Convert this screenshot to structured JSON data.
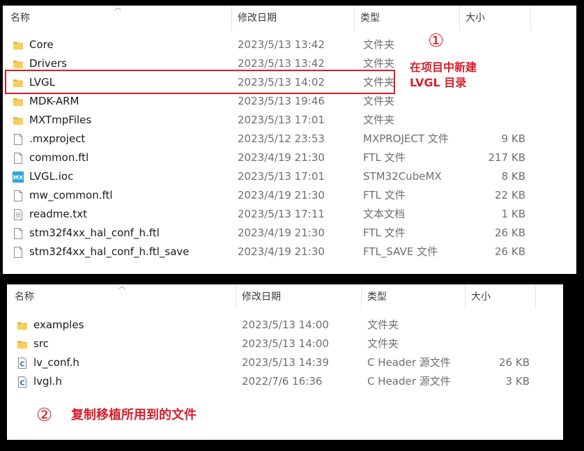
{
  "colors": {
    "accent_red": "#d81e2a",
    "folder_yellow": "#f2c94c",
    "mx_blue": "#2ea3dc"
  },
  "columns": {
    "name": "名称",
    "modified": "修改日期",
    "type": "类型",
    "size": "大小"
  },
  "panel1": {
    "rows": [
      {
        "icon": "folder-icon",
        "name": "Core",
        "modified": "2023/5/13 13:42",
        "type": "文件夹",
        "size": ""
      },
      {
        "icon": "folder-icon",
        "name": "Drivers",
        "modified": "2023/5/13 13:42",
        "type": "文件夹",
        "size": ""
      },
      {
        "icon": "folder-icon",
        "name": "LVGL",
        "modified": "2023/5/13 14:02",
        "type": "文件夹",
        "size": ""
      },
      {
        "icon": "folder-icon",
        "name": "MDK-ARM",
        "modified": "2023/5/13 19:46",
        "type": "文件夹",
        "size": ""
      },
      {
        "icon": "folder-icon",
        "name": "MXTmpFiles",
        "modified": "2023/5/13 17:01",
        "type": "文件夹",
        "size": ""
      },
      {
        "icon": "file-icon",
        "name": ".mxproject",
        "modified": "2023/5/12 23:53",
        "type": "MXPROJECT 文件",
        "size": "9 KB"
      },
      {
        "icon": "file-icon",
        "name": "common.ftl",
        "modified": "2023/4/19 21:30",
        "type": "FTL 文件",
        "size": "217 KB"
      },
      {
        "icon": "mx-icon",
        "name": "LVGL.ioc",
        "modified": "2023/5/13 17:01",
        "type": "STM32CubeMX",
        "size": "8 KB"
      },
      {
        "icon": "file-icon",
        "name": "mw_common.ftl",
        "modified": "2023/4/19 21:30",
        "type": "FTL 文件",
        "size": "22 KB"
      },
      {
        "icon": "text-file-icon",
        "name": "readme.txt",
        "modified": "2023/5/13 17:11",
        "type": "文本文档",
        "size": "1 KB"
      },
      {
        "icon": "file-icon",
        "name": "stm32f4xx_hal_conf_h.ftl",
        "modified": "2023/4/19 21:30",
        "type": "FTL 文件",
        "size": "26 KB"
      },
      {
        "icon": "file-icon",
        "name": "stm32f4xx_hal_conf_h.ftl_save",
        "modified": "2023/4/19 21:30",
        "type": "FTL_SAVE 文件",
        "size": "26 KB"
      }
    ],
    "annotation_number": "①",
    "annotation_line1": "在项目中新建",
    "annotation_line2": "LVGL 目录"
  },
  "panel2": {
    "rows": [
      {
        "icon": "folder-icon",
        "name": "examples",
        "modified": "2023/5/13 14:00",
        "type": "文件夹",
        "size": ""
      },
      {
        "icon": "folder-icon",
        "name": "src",
        "modified": "2023/5/13 14:00",
        "type": "文件夹",
        "size": ""
      },
      {
        "icon": "c-header-icon",
        "name": "lv_conf.h",
        "modified": "2023/5/13 14:39",
        "type": "C Header 源文件",
        "size": "26 KB"
      },
      {
        "icon": "c-header-icon",
        "name": "lvgl.h",
        "modified": "2022/7/6 16:36",
        "type": "C Header 源文件",
        "size": "3 KB"
      }
    ],
    "annotation_number": "②",
    "annotation_text": "复制移植所用到的文件"
  }
}
